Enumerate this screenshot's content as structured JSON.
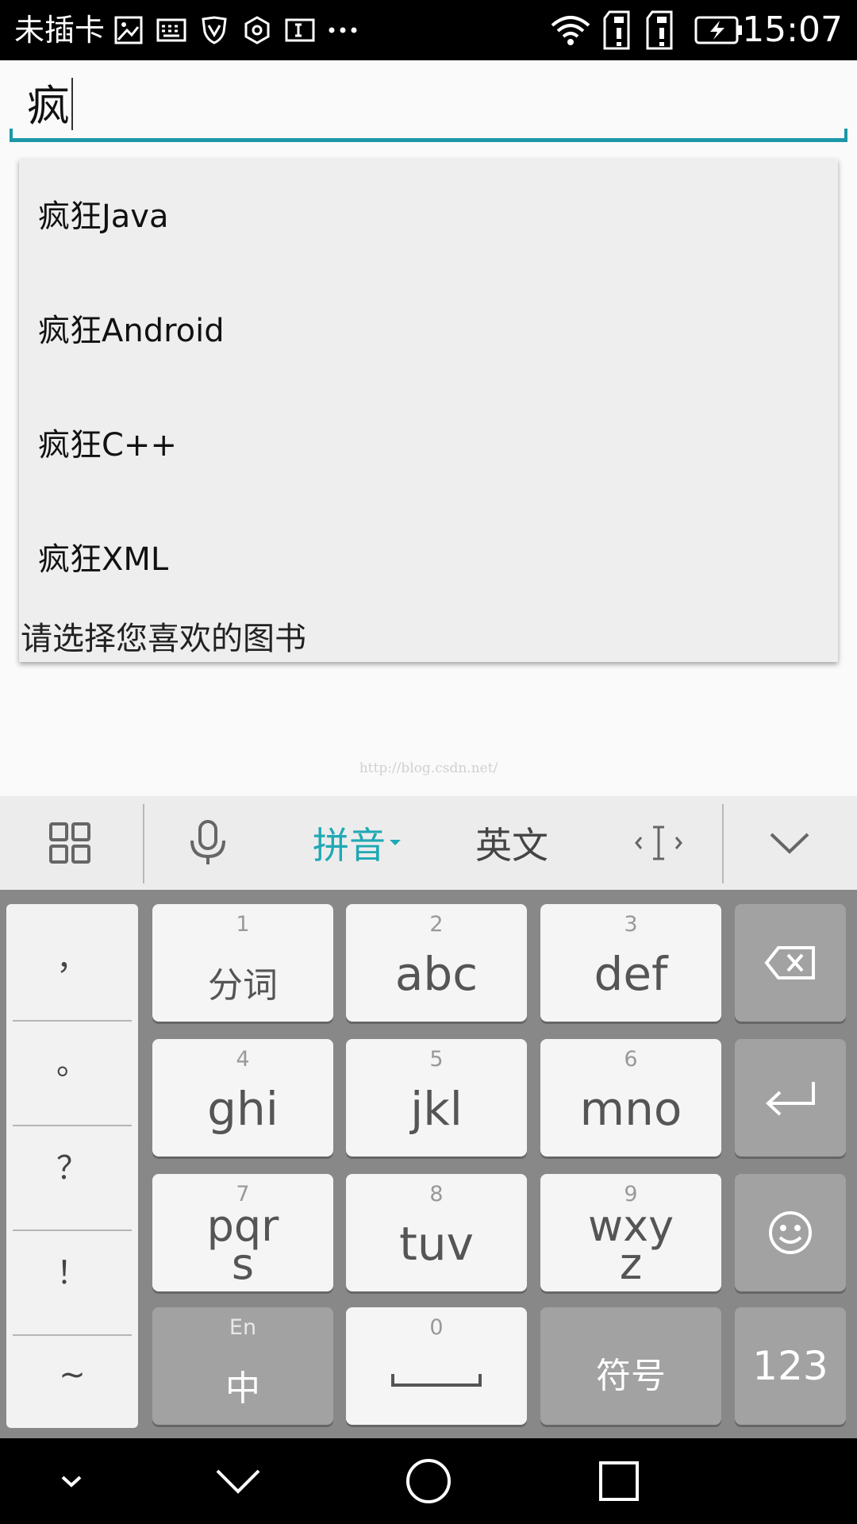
{
  "status_bar": {
    "carrier": "未插卡",
    "time": "15:07",
    "icons": [
      "image-icon",
      "keyboard-icon",
      "shield-icon",
      "hexagon-icon",
      "text-cursor-icon",
      "more-icon",
      "wifi-icon",
      "sim1-icon",
      "sim2-icon",
      "battery-charging-icon"
    ]
  },
  "search": {
    "value": "疯"
  },
  "dropdown": {
    "items": [
      "疯狂Java",
      "疯狂Android",
      "疯狂C++",
      "疯狂XML"
    ],
    "hint": "请选择您喜欢的图书"
  },
  "watermark": "http://blog.csdn.net/",
  "keyboard_toolbar": {
    "pinyin": "拼音",
    "english": "英文",
    "accent": "#1fa9b4"
  },
  "keyboard": {
    "punctuation": [
      "，",
      "。",
      "？",
      "！",
      "~"
    ],
    "keys": [
      {
        "num": "1",
        "label": "分词"
      },
      {
        "num": "2",
        "label": "abc"
      },
      {
        "num": "3",
        "label": "def"
      },
      {
        "num": "4",
        "label": "ghi"
      },
      {
        "num": "5",
        "label": "jkl"
      },
      {
        "num": "6",
        "label": "mno"
      },
      {
        "num": "7",
        "label": "pqr\ns"
      },
      {
        "num": "8",
        "label": "tuv"
      },
      {
        "num": "9",
        "label": "wxy\nz"
      }
    ],
    "lang_key": {
      "sub": "En",
      "label": "中"
    },
    "space_key": {
      "num": "0"
    },
    "symbol_key": "符号",
    "num_key": "123"
  }
}
